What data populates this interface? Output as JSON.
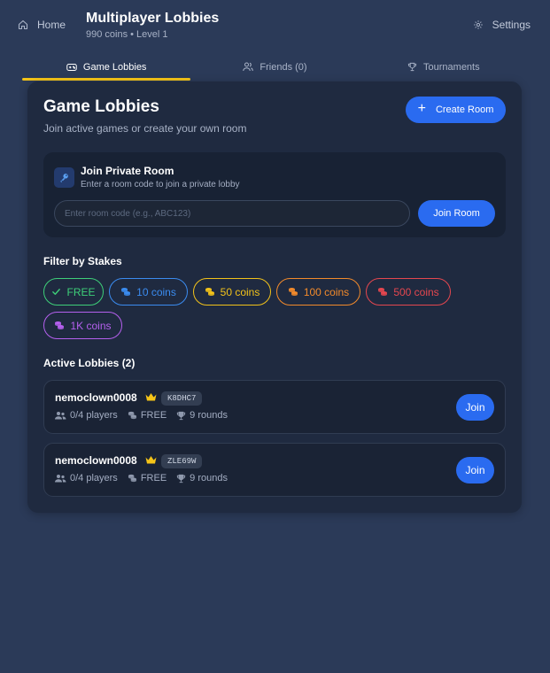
{
  "header": {
    "home_label": "Home",
    "title": "Multiplayer Lobbies",
    "subtitle": "990 coins • Level 1",
    "settings_label": "Settings"
  },
  "tabs": [
    {
      "label": "Game Lobbies",
      "icon": "gamepad-icon",
      "active": true
    },
    {
      "label": "Friends (0)",
      "icon": "users-icon",
      "active": false
    },
    {
      "label": "Tournaments",
      "icon": "trophy-icon",
      "active": false
    }
  ],
  "main": {
    "title": "Game Lobbies",
    "subtitle": "Join active games or create your own room",
    "create_label": "Create Room"
  },
  "private_room": {
    "title": "Join Private Room",
    "subtitle": "Enter a room code to join a private lobby",
    "input_value": "",
    "input_placeholder": "Enter room code (e.g., ABC123)",
    "join_label": "Join Room"
  },
  "filters": {
    "label": "Filter by Stakes",
    "chips": [
      {
        "label": "FREE",
        "icon": "check-icon",
        "color": "#3ecf79"
      },
      {
        "label": "10 coins",
        "icon": "coins-icon",
        "color": "#3b8cf0"
      },
      {
        "label": "50 coins",
        "icon": "coins-icon",
        "color": "#f2c21a"
      },
      {
        "label": "100 coins",
        "icon": "coins-icon",
        "color": "#f28a2b"
      },
      {
        "label": "500 coins",
        "icon": "coins-icon",
        "color": "#e5474f"
      },
      {
        "label": "1K coins",
        "icon": "coins-icon",
        "color": "#b560ee"
      }
    ]
  },
  "lobbies": {
    "label": "Active Lobbies (2)",
    "items": [
      {
        "host": "nemoclown0008",
        "code": "K8DHC7",
        "players": "0/4 players",
        "stake": "FREE",
        "rounds": "9 rounds",
        "join_label": "Join"
      },
      {
        "host": "nemoclown0008",
        "code": "ZLE69W",
        "players": "0/4 players",
        "stake": "FREE",
        "rounds": "9 rounds",
        "join_label": "Join"
      }
    ]
  },
  "colors": {
    "accent": "#2a6bf0",
    "tab_underline": "#f5c418",
    "crown": "#f5c418"
  }
}
